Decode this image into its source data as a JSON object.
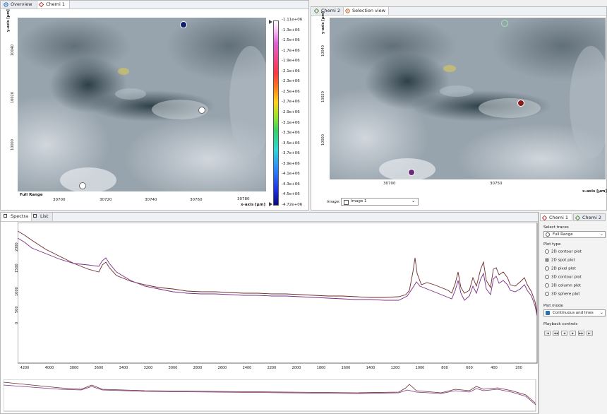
{
  "left_panel": {
    "tabs": [
      {
        "label": "Overview"
      },
      {
        "label": "Chemi 1"
      }
    ],
    "y_axis_label": "y-axis [µm]",
    "y_ticks": [
      "10040",
      "10020",
      "10000"
    ],
    "x_ticks": [
      "30700",
      "30720",
      "30740",
      "30760",
      "30780"
    ],
    "x_axis_label": "x-axis [µm]",
    "range_label": "Full Range",
    "colorbar_labels": [
      "-1.11e+06",
      "-1.3e+06",
      "-1.5e+06",
      "-1.7e+06",
      "-1.9e+06",
      "-2.1e+06",
      "-2.3e+06",
      "-2.5e+06",
      "-2.7e+06",
      "-2.9e+06",
      "-3.1e+06",
      "-3.3e+06",
      "-3.5e+06",
      "-3.7e+06",
      "-3.9e+06",
      "-4.1e+06",
      "-4.3e+06",
      "-4.5e+06",
      "-4.72e+06"
    ]
  },
  "right_panel": {
    "tabs": [
      {
        "label": "Chemi 2"
      },
      {
        "label": "Selection view"
      }
    ],
    "y_axis_label": "y-axis [µm]",
    "y_ticks": [
      "10040",
      "10020",
      "10000"
    ],
    "x_ticks": [
      "30700",
      "30750"
    ],
    "x_axis_label": "x-axis [µm]",
    "image_label": "Image:",
    "image_value": "Image 1"
  },
  "spectra_panel": {
    "tabs": [
      {
        "label": "Spectra"
      },
      {
        "label": "List"
      }
    ],
    "y_ticks": [
      "2000",
      "1500",
      "1000",
      "500",
      "0"
    ],
    "x_ticks": [
      "4200",
      "4000",
      "3800",
      "3600",
      "3400",
      "3200",
      "3000",
      "2800",
      "2600",
      "2400",
      "2200",
      "2000",
      "1800",
      "1600",
      "1400",
      "1200",
      "1000",
      "800",
      "600",
      "400",
      "200"
    ]
  },
  "side_panel": {
    "tabs": [
      {
        "label": "Chemi 1"
      },
      {
        "label": "Chemi 2"
      }
    ],
    "select_traces_label": "Select traces",
    "select_traces_value": "Full Range",
    "plot_type_label": "Plot type",
    "plot_types": [
      {
        "label": "2D contour plot",
        "selected": false
      },
      {
        "label": "2D spot plot",
        "selected": true
      },
      {
        "label": "2D pixel plot",
        "selected": false
      },
      {
        "label": "3D contour plot",
        "selected": false
      },
      {
        "label": "3D column plot",
        "selected": false
      },
      {
        "label": "3D sphere plot",
        "selected": false
      }
    ],
    "plot_mode_label": "Plot mode",
    "plot_mode_value": "Continuous and lines",
    "playback_label": "Playback controls",
    "playback_buttons": [
      "|◀",
      "◀◀",
      "◀",
      "▶",
      "▶▶",
      "▶|"
    ]
  },
  "colors": {
    "series_brown": "#6e2a2a",
    "series_purple": "#7a2f86",
    "spot_blue": "#0f1f6e",
    "spot_red": "#8b1a1a",
    "spot_purple": "#6a2a7a"
  }
}
